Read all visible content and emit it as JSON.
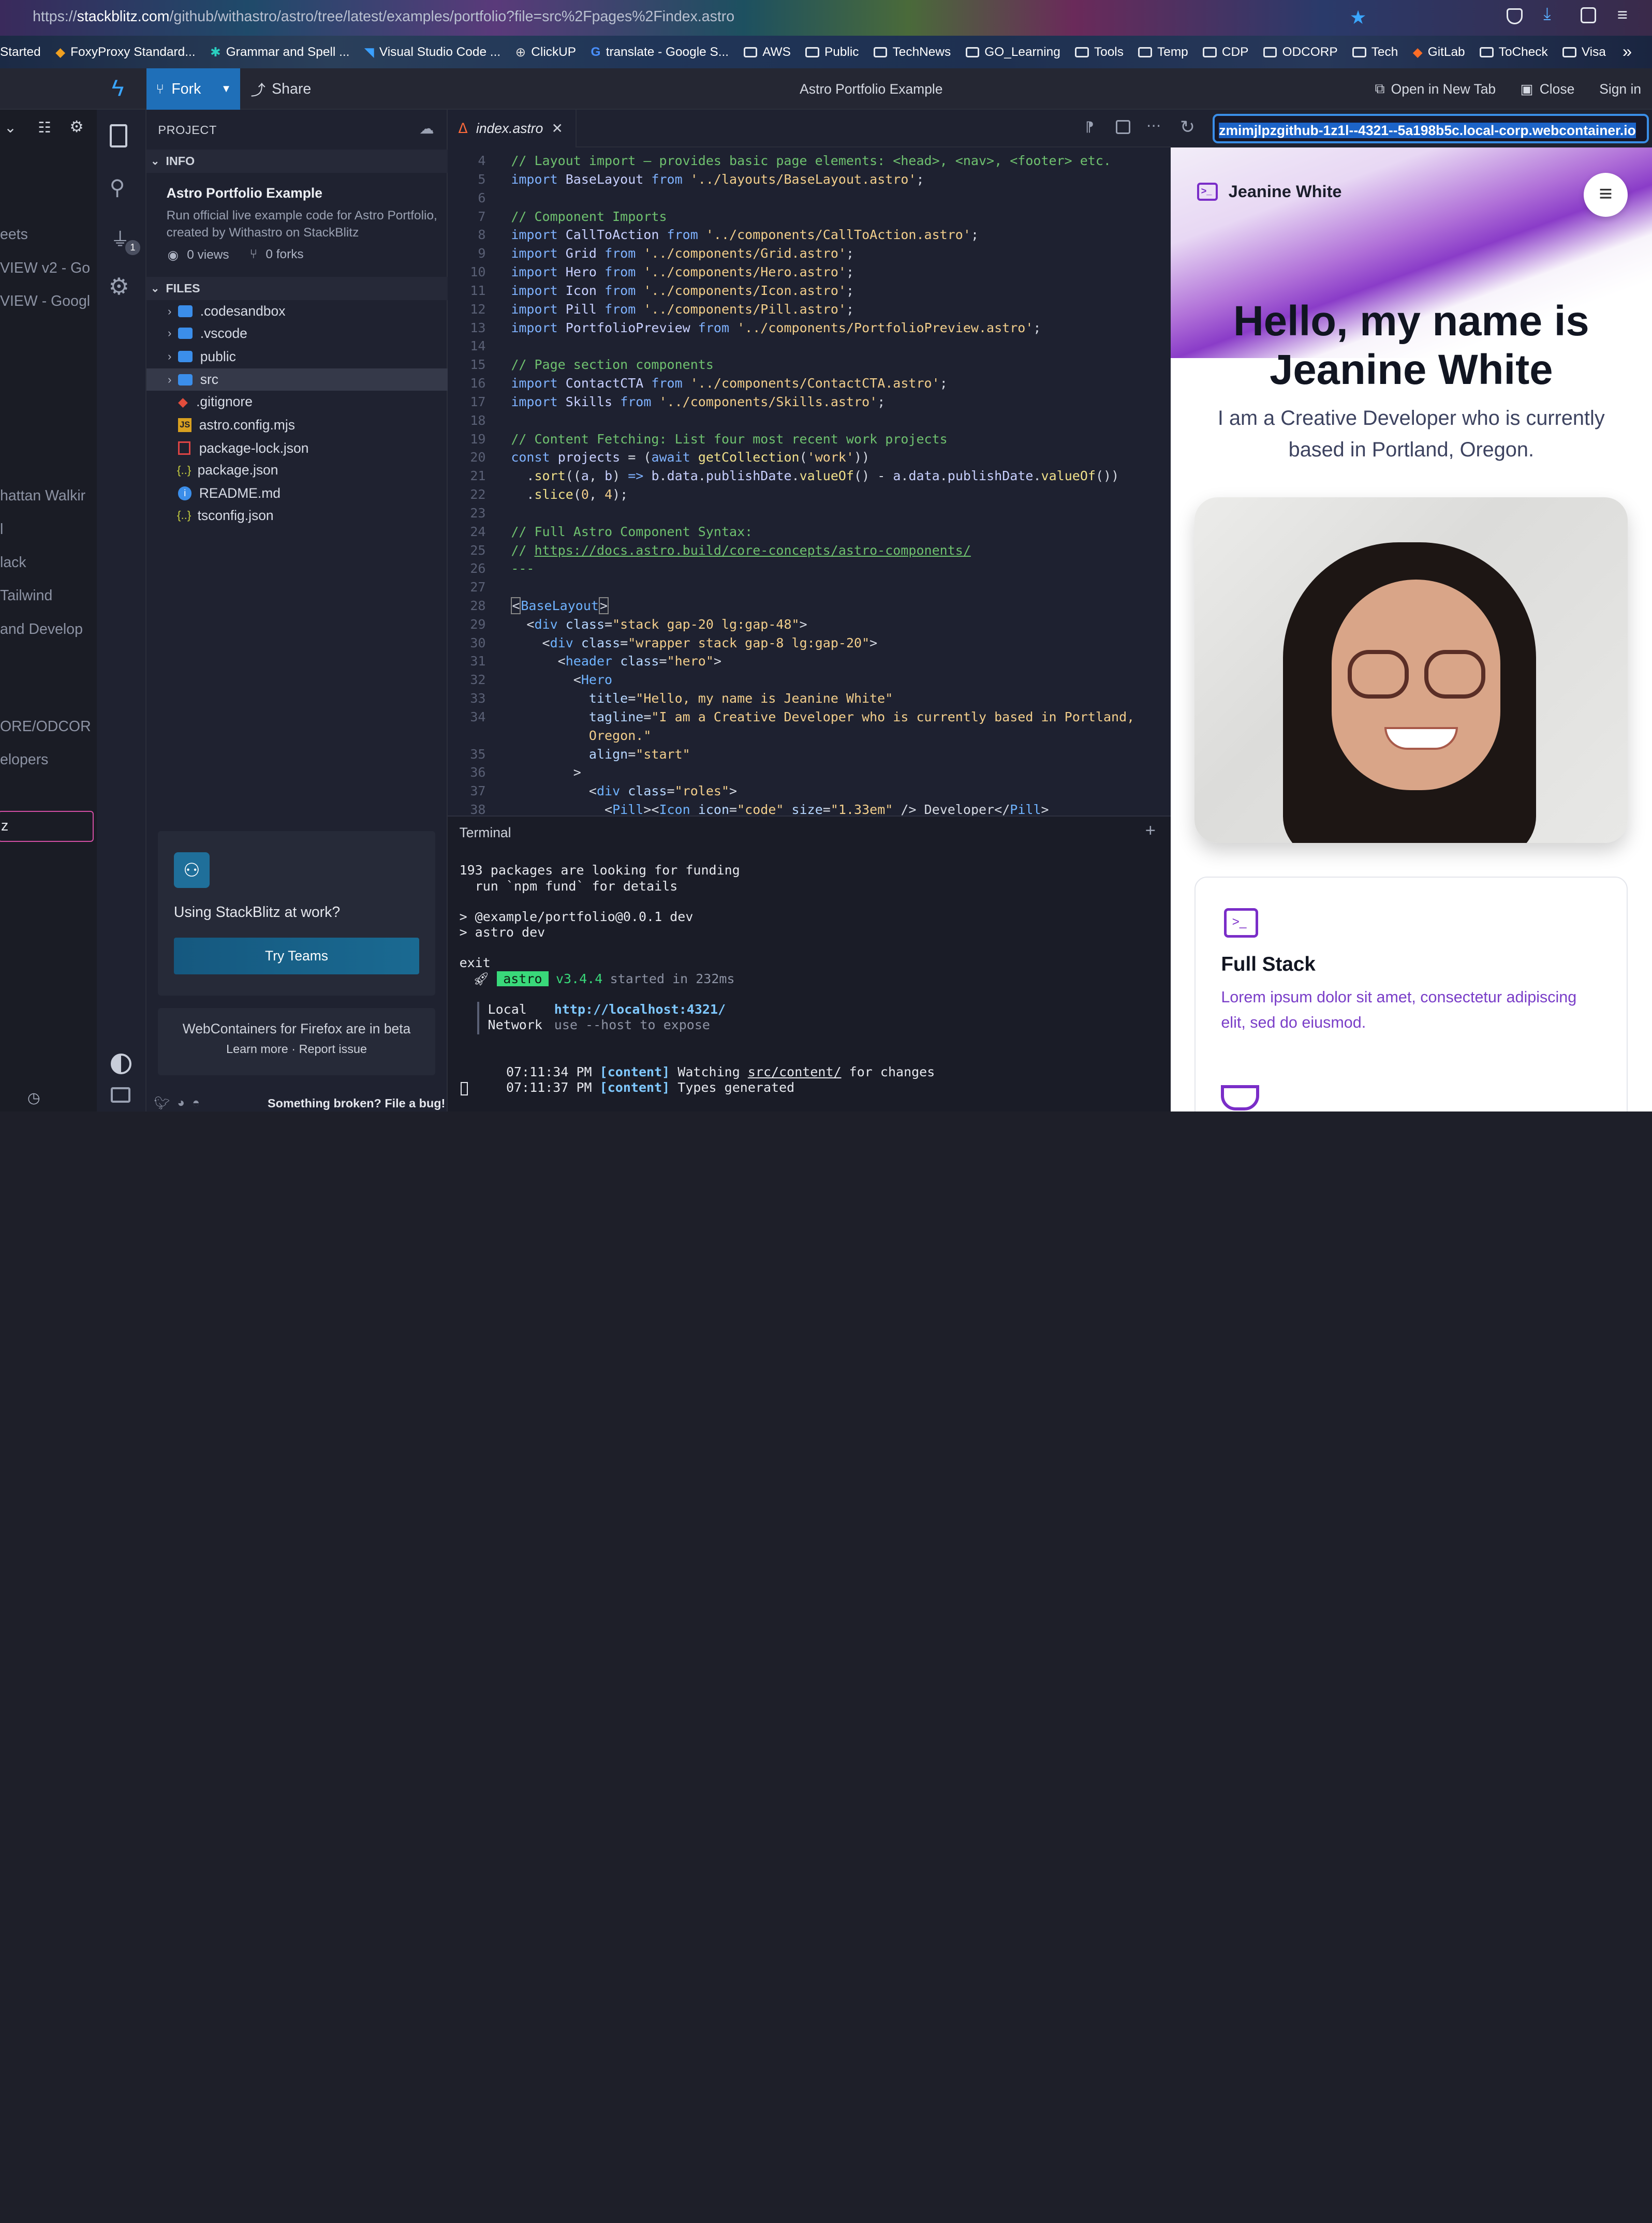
{
  "browser": {
    "url_prefix": "https://",
    "url_host": "stackblitz.com",
    "url_path": "/github/withastro/astro/tree/latest/examples/portfolio?file=src%2Fpages%2Findex.astro",
    "bookmarks": [
      "Started",
      "FoxyProxy Standard...",
      "Grammar and Spell ...",
      "Visual Studio Code ...",
      "ClickUP",
      "translate - Google S...",
      "AWS",
      "Public",
      "TechNews",
      "GO_Learning",
      "Tools",
      "Temp",
      "CDP",
      "ODCORP",
      "Tech",
      "GitLab",
      "ToCheck",
      "Visa"
    ],
    "more": "»"
  },
  "left_panel": {
    "items": [
      "eets",
      "VIEW v2 - Go",
      "VIEW - Googl",
      "hattan Walkir",
      "l",
      "lack",
      " Tailwind",
      " and Develop",
      "ORE/ODCOR",
      "elopers",
      "z"
    ]
  },
  "appbar": {
    "fork": "Fork",
    "share": "Share",
    "title": "Astro Portfolio Example",
    "open_new_tab": "Open in New Tab",
    "close": "Close",
    "sign_in": "Sign in"
  },
  "sidebar": {
    "project_label": "PROJECT",
    "info_label": "INFO",
    "project_title": "Astro Portfolio Example",
    "project_desc": "Run official live example code for Astro Portfolio, created by Withastro on StackBlitz",
    "views": "0 views",
    "forks": "0 forks",
    "files_label": "FILES",
    "files": [
      {
        "name": ".codesandbox",
        "type": "folder"
      },
      {
        "name": ".vscode",
        "type": "folder"
      },
      {
        "name": "public",
        "type": "folder"
      },
      {
        "name": "src",
        "type": "folder"
      },
      {
        "name": ".gitignore",
        "type": "file"
      },
      {
        "name": "astro.config.mjs",
        "type": "file"
      },
      {
        "name": "package-lock.json",
        "type": "file"
      },
      {
        "name": "package.json",
        "type": "file"
      },
      {
        "name": "README.md",
        "type": "file"
      },
      {
        "name": "tsconfig.json",
        "type": "file"
      }
    ],
    "teams_title": "Using StackBlitz at work?",
    "teams_button": "Try Teams",
    "beta_text": "WebContainers for Firefox are in beta",
    "learn_more": "Learn more",
    "report_issue": "Report issue",
    "footer_text": "Something broken? File a bug!",
    "badge_count": "1"
  },
  "editor": {
    "tab_name": "index.astro",
    "preview_url": "zmimjlpzgithub-1z1l--4321--5a198b5c.local-corp.webcontainer.io",
    "line_numbers": [
      "4",
      "5",
      "6",
      "7",
      "8",
      "9",
      "10",
      "11",
      "12",
      "13",
      "14",
      "15",
      "16",
      "17",
      "18",
      "19",
      "20",
      "21",
      "22",
      "23",
      "24",
      "25",
      "26",
      "27",
      "28",
      "29",
      "30",
      "31",
      "32",
      "33",
      "34",
      "",
      "35",
      "36",
      "37",
      "38"
    ]
  },
  "terminal": {
    "label": "Terminal",
    "lines": {
      "l1": "193 packages are looking for funding",
      "l2": "  run `npm fund` for details",
      "l3": "> @example/portfolio@0.0.1 dev",
      "l4": "> astro dev",
      "l5": "exit",
      "astro_badge": "astro",
      "version": "v3.4.4",
      "started": "started in 232ms",
      "local_label": "Local",
      "local_url": "http://localhost:4321/",
      "network_label": "Network",
      "network_value": "use --host to expose",
      "t1": "07:11:34 PM",
      "t2": "07:11:37 PM",
      "content_tag": "[content]",
      "watch1": "Watching",
      "watch_path": "src/content/",
      "watch2": "for changes",
      "types": "Types generated"
    }
  },
  "preview": {
    "brand": "Jeanine White",
    "hero_title_1": "Hello, my name is",
    "hero_title_2": "Jeanine White",
    "tagline": "I am a Creative Developer who is currently based in Portland, Oregon.",
    "card_title": "Full Stack",
    "card_text": "Lorem ipsum dolor sit amet, consectetur adipiscing elit, sed do eiusmod."
  }
}
